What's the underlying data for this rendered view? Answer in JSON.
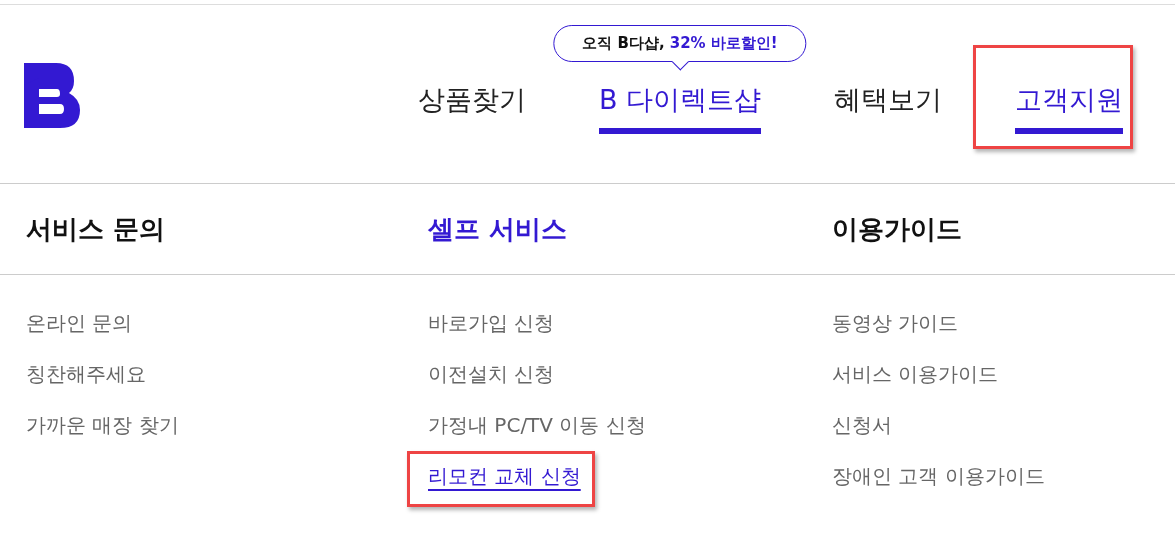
{
  "nav": {
    "items": [
      {
        "label": "상품찾기",
        "selected": false,
        "highlighted": false
      },
      {
        "label": "B 다이렉트샵",
        "selected": true,
        "highlighted": false,
        "tooltip": {
          "lead": "오직 B다샵,",
          "accent": "32% 바로할인!"
        }
      },
      {
        "label": "혜택보기",
        "selected": false,
        "highlighted": false
      },
      {
        "label": "고객지원",
        "selected": true,
        "highlighted": true
      }
    ]
  },
  "menu": {
    "columns": [
      {
        "heading": "서비스 문의",
        "selected": false,
        "links": [
          {
            "label": "온라인 문의",
            "selected": false,
            "highlighted": false
          },
          {
            "label": "칭찬해주세요",
            "selected": false,
            "highlighted": false
          },
          {
            "label": "가까운 매장 찾기",
            "selected": false,
            "highlighted": false
          }
        ]
      },
      {
        "heading": "셀프 서비스",
        "selected": true,
        "links": [
          {
            "label": "바로가입 신청",
            "selected": false,
            "highlighted": false
          },
          {
            "label": "이전설치 신청",
            "selected": false,
            "highlighted": false
          },
          {
            "label": "가정내 PC/TV 이동 신청",
            "selected": false,
            "highlighted": false
          },
          {
            "label": "리모컨 교체 신청",
            "selected": true,
            "highlighted": true
          }
        ]
      },
      {
        "heading": "이용가이드",
        "selected": false,
        "links": [
          {
            "label": "동영상 가이드",
            "selected": false,
            "highlighted": false
          },
          {
            "label": "서비스 이용가이드",
            "selected": false,
            "highlighted": false
          },
          {
            "label": "신청서",
            "selected": false,
            "highlighted": false
          },
          {
            "label": "장애인 고객 이용가이드",
            "selected": false,
            "highlighted": false
          }
        ]
      }
    ]
  }
}
